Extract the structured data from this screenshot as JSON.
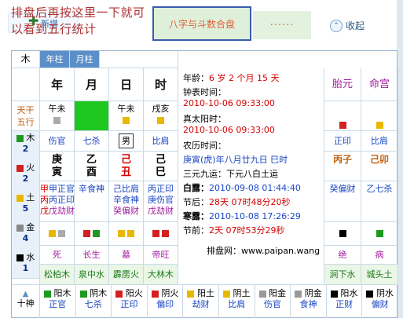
{
  "toolbar": {
    "hint": "排盘后再按这里一下就可以看到五行统计",
    "new_label": "新增",
    "calc_button": "八字与斗数合盘",
    "dots": "······",
    "collapse_label": "收起"
  },
  "chart": {
    "corner": "木",
    "year_pillar_header": "年柱",
    "month_pillar_header": "月柱",
    "columns": [
      "年",
      "月",
      "日",
      "时"
    ],
    "side_labels": {
      "tiangan_wuxing": "天干\n五行"
    },
    "hidden_pairs": [
      "午未",
      "",
      "午未",
      "戌亥"
    ],
    "wuxing_counts": [
      {
        "el": "木",
        "n": "2",
        "color": "#1e9a1e"
      },
      {
        "el": "火",
        "n": "2",
        "color": "#d42020"
      },
      {
        "el": "土",
        "n": "5",
        "color": "#e8b800"
      },
      {
        "el": "金",
        "n": "4",
        "color": "#888888"
      },
      {
        "el": "水",
        "n": "1",
        "color": "#000000"
      }
    ],
    "tengods": [
      "伤官",
      "七杀",
      "男",
      "比肩"
    ],
    "stems": [
      "庚",
      "乙",
      "己",
      "己"
    ],
    "branches": [
      "寅",
      "酉",
      "丑",
      "巳"
    ],
    "hidden_rows": [
      [
        "甲正官",
        "辛食神",
        "己比肩",
        "丙正印"
      ],
      [
        "丙正印",
        "",
        "辛食神",
        "庚伤官"
      ],
      [
        "戊劫财",
        "",
        "癸偏财",
        "戊劫财"
      ]
    ],
    "changsheng": [
      "死",
      "长生",
      "墓",
      "帝旺"
    ],
    "nayin": [
      "松柏木",
      "泉中水",
      "霹雳火",
      "大林木"
    ],
    "bottom_row": [
      "阳木",
      "阴木",
      "阳火",
      "阴火",
      "阳土",
      "阴土",
      "阳金",
      "阴金",
      "阳水",
      "阴水"
    ],
    "bottom_gods": [
      "正官",
      "七杀",
      "正印",
      "偏印",
      "劫财",
      "比肩",
      "伤官",
      "食神",
      "正财",
      "偏财"
    ],
    "bottom_left": "十神",
    "info": {
      "age_label": "年龄：",
      "age": "6 岁 2 个月 15 天",
      "clock_label": "钟表时间：",
      "clock_time": "2010-10-06 09:33:00",
      "solar_label": "真太阳时：",
      "solar_time": "2010-10-06 09:33:00",
      "lunar_label": "农历时间：",
      "lunar_time": "庚寅(虎)年八月廿九日 巳时",
      "sanyuan": "三元九运：下元八白土运",
      "bailu_label": "白露：",
      "bailu": "2010-09-08 01:44:40",
      "after_label": "节后：",
      "after": "28天 07时48分20秒",
      "hanlu_label": "寒露：",
      "hanlu": "2010-10-08 17:26:29",
      "before_label": "节前：",
      "before": "2天 07时53分29秒",
      "site": "排盘网：www.paipan.wang"
    },
    "right": {
      "taiyuan": "胎元",
      "minggong": "命宫",
      "tengods": [
        "正印",
        "比肩"
      ],
      "stems": [
        "丙子",
        "己卯"
      ],
      "hidden": [
        "癸偏财",
        "乙七杀"
      ],
      "changsheng": [
        "绝",
        "病"
      ],
      "nayin": [
        "涧下水",
        "城头土"
      ]
    }
  },
  "colors": {
    "header_blue": "#5b8fc9",
    "accent_red": "#d60000",
    "highlight_green": "#1ec81e"
  }
}
